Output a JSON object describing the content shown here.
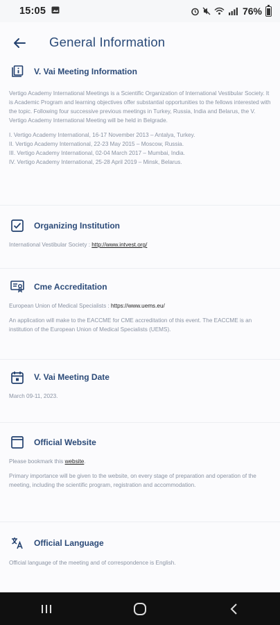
{
  "status": {
    "time": "15:05",
    "battery": "76%"
  },
  "header": {
    "title": "General Information"
  },
  "sections": [
    {
      "title": "V. Vai Meeting Information",
      "icon": "info-icon",
      "paragraph": "Vertigo Academy International Meetings is a Scientific Organization of International Vestibular Society. It is Academic Program and learning objectives offer substantial opportunities to the fellows interested with the topic. Following four successive previous meetings in Turkey, Russia, India and Belarus, the V. Vertigo Academy International Meeting will be held in Belgrade.",
      "list": [
        "I. Vertigo Academy International, 16-17 November 2013 – Antalya, Turkey.",
        "II. Vertigo Academy International, 22-23 May 2015 – Moscow, Russia.",
        "III. Vertigo Academy International, 02-04 March 2017 – Mumbai, India.",
        "IV. Vertigo Academy International, 25-28 April 2019 – Minsk, Belarus."
      ]
    },
    {
      "title": "Organizing Institution",
      "icon": "checkbox-icon",
      "label": "International Vestibular Society : ",
      "link": "http://www.intvest.org/"
    },
    {
      "title": "Cme Accreditation",
      "icon": "certificate-icon",
      "label": "European Union of Medical Specialists : ",
      "link": "https://www.uems.eu/",
      "paragraph": "An application will make to the EACCME for CME accreditation of this event. The EACCME is an institution of the European Union of Medical Specialists (UEMS)."
    },
    {
      "title": "V. Vai Meeting Date",
      "icon": "calendar-icon",
      "paragraph": "March 09-11, 2023."
    },
    {
      "title": "Official Website",
      "icon": "browser-window-icon",
      "label": "Please bookmark this ",
      "link": "website",
      "paragraph": "Primary importance will be given to the website, on every stage of preparation and operation of the meeting, including the scientific program, registration and accommodation."
    },
    {
      "title": "Official Language",
      "icon": "translate-icon",
      "paragraph": "Official language of the meeting and of correspondence is English."
    }
  ],
  "navbar": {
    "recents": "recent-apps-icon",
    "home": "home-icon",
    "back": "back-chevron-icon"
  },
  "colors": {
    "title": "#2b4a78",
    "body_text": "#8a93a3",
    "nav_bg": "#101010"
  }
}
